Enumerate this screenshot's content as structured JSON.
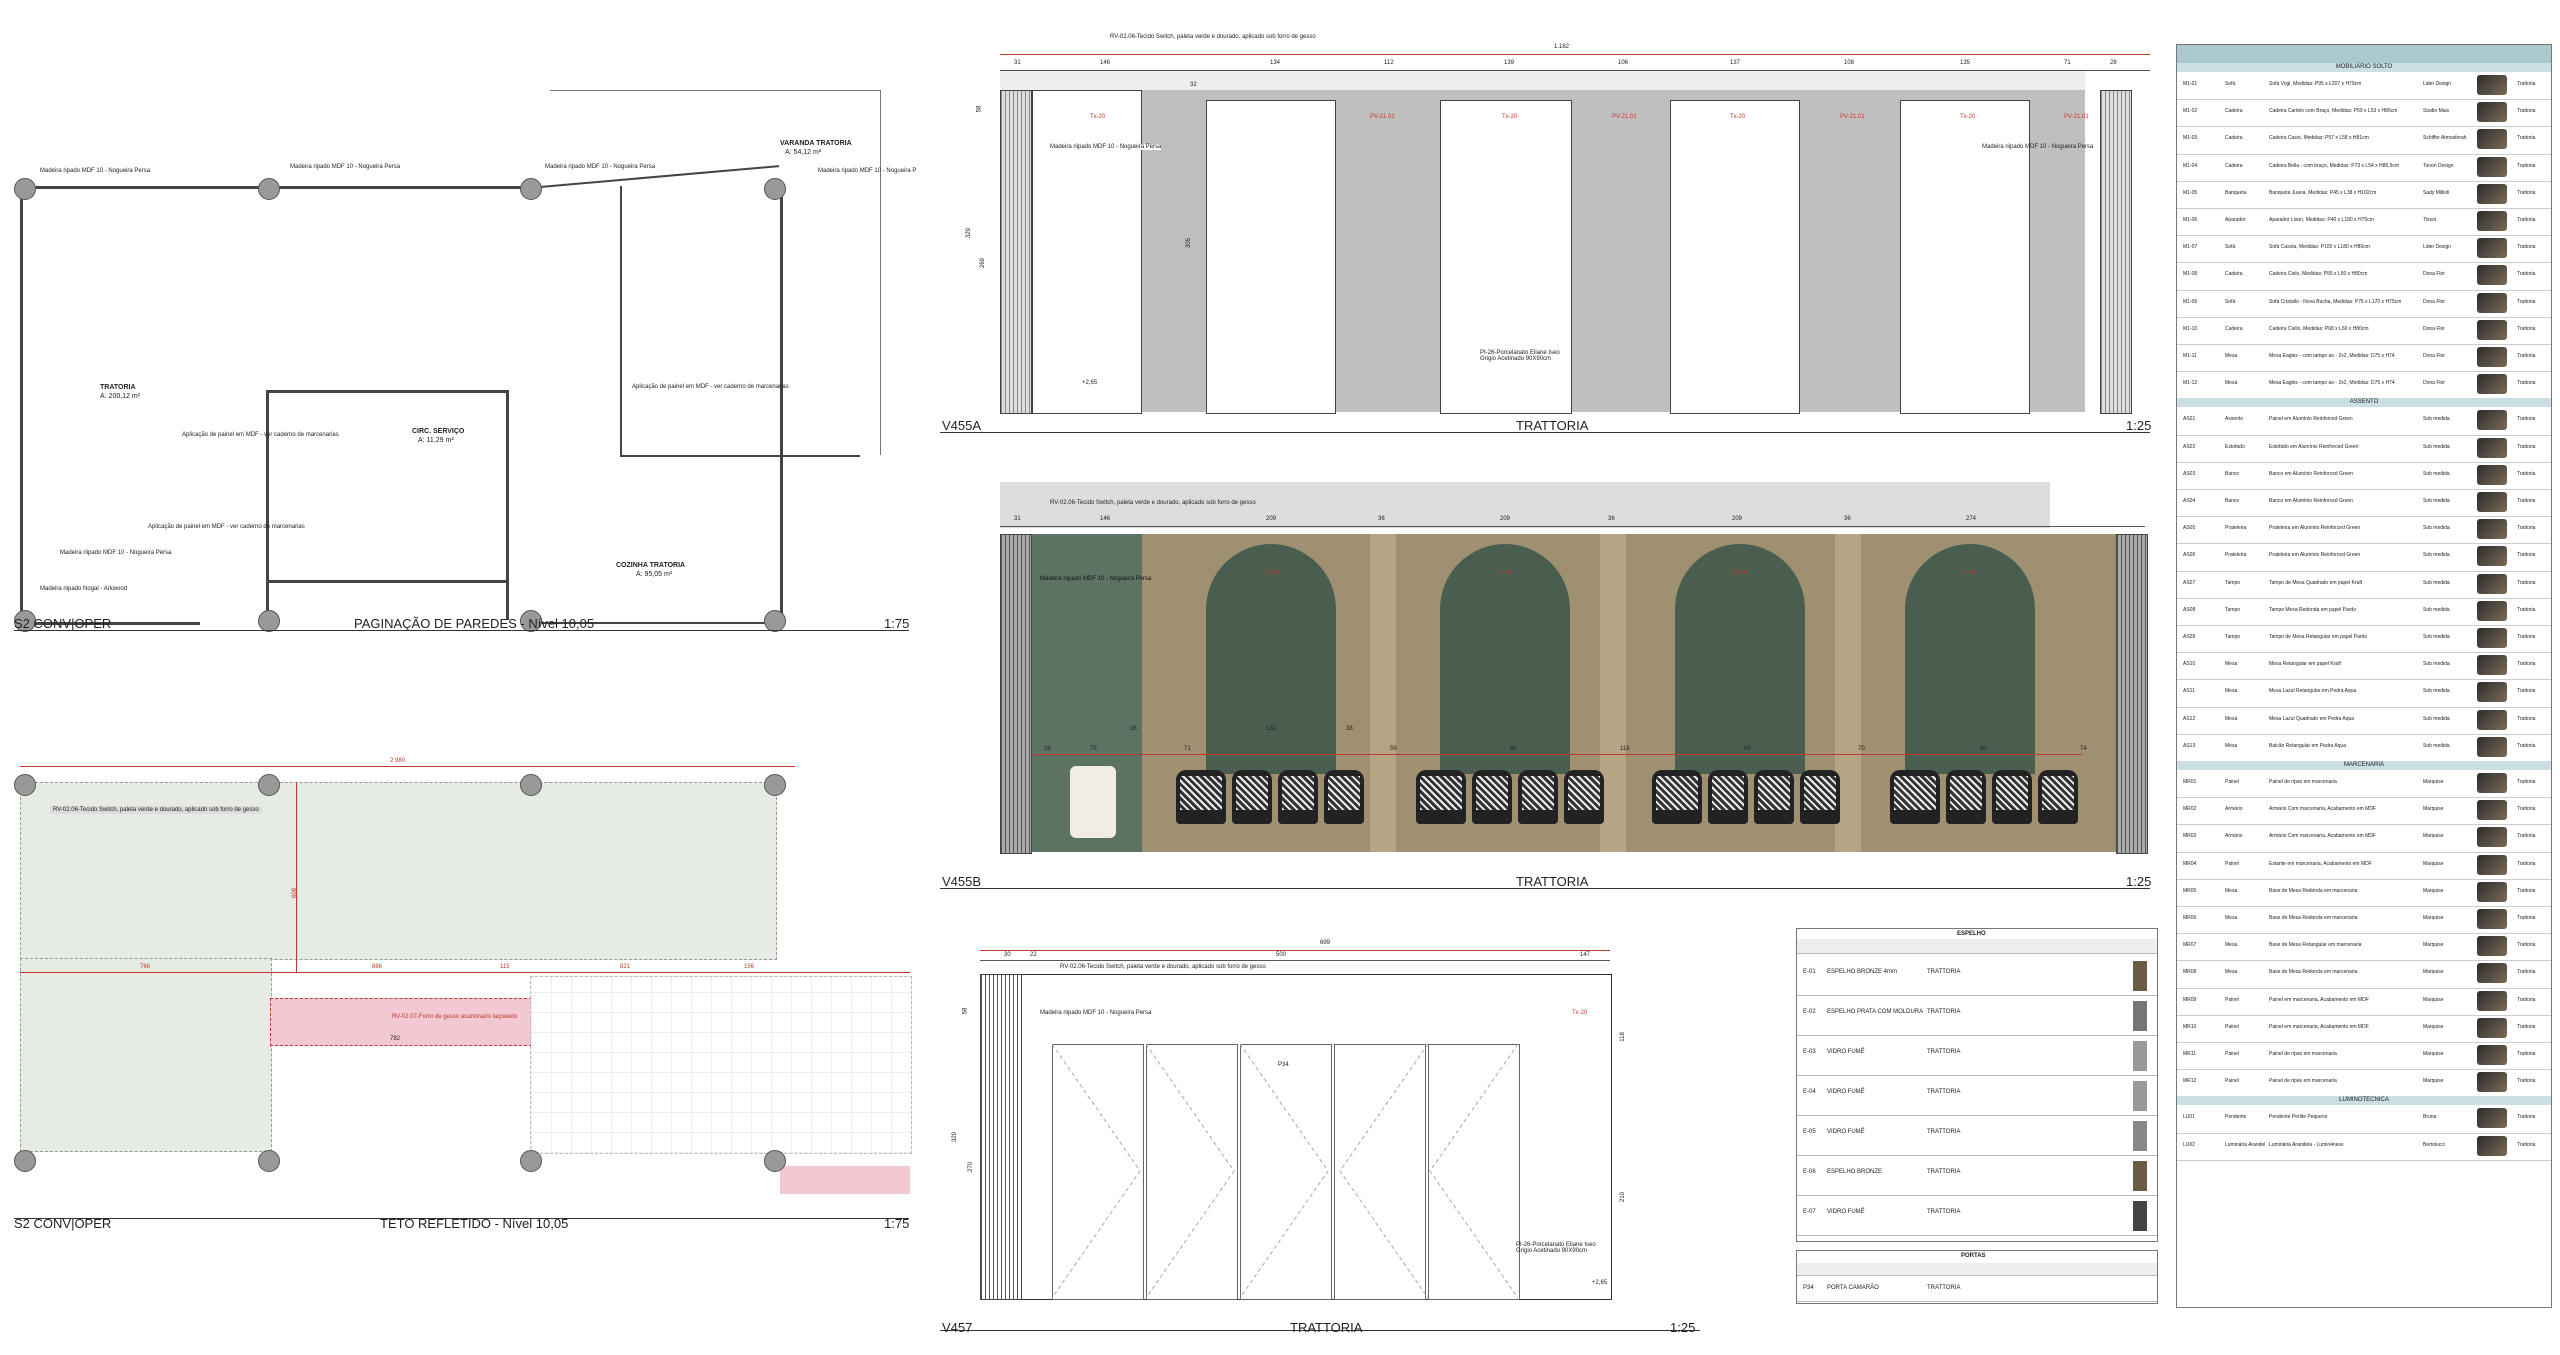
{
  "plan1": {
    "drawing_code": "S2 CONV|OPER",
    "title": "PAGINAÇÃO DE PAREDES - Nível 10,05",
    "scale": "1:75",
    "rooms": [
      {
        "name": "TRATORIA",
        "area": "A: 200,12 m²"
      },
      {
        "name": "VARANDA TRATORIA",
        "area": "A: 54,12 m²"
      },
      {
        "name": "CIRC. SERVIÇO",
        "area": "A: 11,29 m²"
      },
      {
        "name": "COZINHA TRATORIA",
        "area": "A: 95,05 m²"
      }
    ],
    "notes": [
      "Madeira ripado MDF 10 - Nogueira Persa",
      "Madeira ripado MDF 10 - Nogueira Persa",
      "Madeira ripado MDF 10 - Nogueira Persa",
      "Madeira ripado MDF 10 - Nogueira P",
      "Aplicação de painel em MDF - ver caderno de marcenarias",
      "Aplicação de painel em MDF - ver caderno de marcenarias",
      "Aplicação de painel em MDF - ver caderno de marcenarias",
      "Madeira riipado Nogal - Arkwood",
      "Madeira riipado MDF 10 - Nogueira Persa"
    ]
  },
  "plan2": {
    "drawing_code": "S2 CONV|OPER",
    "title": "TETO REFLETIDO - Nível 10,05",
    "scale": "1:75",
    "notes": [
      "RV-02.06-Tecido Switch, paleta verde e dourado, aplicado sob forro de gesso",
      "RV-02.07-Forro de gesso acartonado laqueado"
    ],
    "dims": [
      "2.980",
      "766",
      "866",
      "115",
      "821",
      "156",
      "608",
      "782"
    ]
  },
  "elev_a": {
    "code": "V455A",
    "title": "TRATTORIA",
    "scale": "1:25",
    "top_note": "RV-02.06-Tecido Switch, paleta verde e dourado, aplicado sob forro de gesso",
    "total_dim": "1.182",
    "dims": [
      "31",
      "146",
      "32",
      "134",
      "112",
      "139",
      "106",
      "137",
      "108",
      "135",
      "71",
      "28"
    ],
    "notes": [
      "Madeira riipado MDF 10 - Nogueira Persa",
      "Madeira riipado MDF 10 - Nogueira Persa",
      "PI-26-Porcelanato Eliane Iseo Grigio Acetinado 90X90cm"
    ],
    "tags": [
      "Tx-20",
      "PV-21.01",
      "Tx-20",
      "PV-21.01",
      "Tx-20",
      "PV-21.01",
      "Tx-20",
      "PV-21.01"
    ],
    "level": "+2,65",
    "vert_dims": [
      "329",
      "269",
      "305",
      "58"
    ]
  },
  "elev_b": {
    "code": "V455B",
    "title": "TRATTORIA",
    "scale": "1:25",
    "top_note": "RV-02.06-Tecido Switch, paleta verde e dourado, aplicado sob forro de gesso",
    "dims": [
      "31",
      "146",
      "209",
      "36",
      "209",
      "36",
      "209",
      "36",
      "274"
    ],
    "lower_dims": [
      "29",
      "75",
      "28",
      "71",
      "132",
      "38",
      "59",
      "80",
      "118",
      "89",
      "70",
      "80",
      "74"
    ],
    "notes": [
      "Madeira riipado MDF 10 - Nogueira Persa"
    ],
    "tags": [
      "Tx-20",
      "Tx-20",
      "Tx-20",
      "Tx-20"
    ]
  },
  "elev_c": {
    "code": "V457",
    "title": "TRATTORIA",
    "scale": "1:25",
    "top_note": "RV-02.06-Tecido Switch, paleta verde e dourado, aplicado sob forro de gesso",
    "total_dim": "699",
    "dims": [
      "30",
      "22",
      "500",
      "147"
    ],
    "notes": [
      "Madeira riipado MDF 10 - Nogueira Persa",
      "PI-26-Porcelanato Eliane Iseo Grigio Acetinado 90X90cm"
    ],
    "tag": "Tx-20",
    "door_tag": "P34",
    "level": "+2,65",
    "vert_dims": [
      "58",
      "329",
      "270",
      "118",
      "210"
    ]
  },
  "schedule": {
    "sections": [
      "MOBILIÁRIO SOLTO",
      "ASSENTO",
      "MARCENARIA",
      "LUMINOTECNICA"
    ],
    "rows": [
      {
        "code": "M1-01",
        "item": "Sofá",
        "desc": "Sofá Vogl, Medidas: P95 x L207 x H79cm",
        "supplier": "Lider Design",
        "loc": "Trattoria"
      },
      {
        "code": "M1-02",
        "item": "Cadeira",
        "desc": "Cadeira Carteio com Braço, Medidas: P59 x L53 x H86cm",
        "supplier": "Studio Mais",
        "loc": "Trattoria"
      },
      {
        "code": "M1-03",
        "item": "Cadeira",
        "desc": "Cadeira Casio, Medidas: P57 x L58 x H81cm",
        "supplier": "Schiffer Atmosferah",
        "loc": "Trattoria"
      },
      {
        "code": "M1-04",
        "item": "Cadeira",
        "desc": "Cadeira Bella - com braço, Medidas: P73 x L54 x H86,5cm",
        "supplier": "Tonon Design",
        "loc": "Trattoria"
      },
      {
        "code": "M1-05",
        "item": "Banqueta",
        "desc": "Banqueta Juana, Medidas: P45 x L38 x H102cm",
        "supplier": "Sady Millioli",
        "loc": "Trattoria"
      },
      {
        "code": "M1-06",
        "item": "Aparador",
        "desc": "Aparador Lison, Medidas: P40 x L180 x H75cm",
        "supplier": "Tissot",
        "loc": "Trattoria"
      },
      {
        "code": "M1-07",
        "item": "Sofá",
        "desc": "Sofá Casola, Medidas: P100 x L180 x H80cm",
        "supplier": "Lider Design",
        "loc": "Trattoria"
      },
      {
        "code": "M1-08",
        "item": "Cadeira",
        "desc": "Cadeira Cielo, Medidas: P55 x L50 x H80cm",
        "supplier": "Dona Flor",
        "loc": "Trattoria"
      },
      {
        "code": "M1-09",
        "item": "Sofá",
        "desc": "Sofá Cristallo - Nova Bucha, Medidas: P75 x L170 x H75cm",
        "supplier": "Dona Flor",
        "loc": "Trattoria"
      },
      {
        "code": "M1-10",
        "item": "Cadeira",
        "desc": "Cadeira Ciello, Medidas: P68 x L60 x H80cm",
        "supplier": "Dona Flor",
        "loc": "Trattoria"
      },
      {
        "code": "M1-11",
        "item": "Mesa",
        "desc": "Mesa Eagles - com tampo ao - 2x2, Medidas: D75 x H74",
        "supplier": "Dona Flor",
        "loc": "Trattoria"
      },
      {
        "code": "M1-12",
        "item": "Mesa",
        "desc": "Mesa Eagles - com tampo ao - 2x2, Medidas: D75 x H74",
        "supplier": "Dona Flor",
        "loc": "Trattoria"
      },
      {
        "code": "AS01",
        "item": "Assento",
        "desc": "Painel em Alumínio Reinforced Green",
        "supplier": "Sob medida",
        "loc": "Trattoria"
      },
      {
        "code": "AS02",
        "item": "Estofado",
        "desc": "Estofado em Alumínio Reinforced Green",
        "supplier": "Sob medida",
        "loc": "Trattoria"
      },
      {
        "code": "AS03",
        "item": "Banco",
        "desc": "Banco em Alumínio Reinforced Green",
        "supplier": "Sob medida",
        "loc": "Trattoria"
      },
      {
        "code": "AS04",
        "item": "Banco",
        "desc": "Banco em Alumínio Reinforced Green",
        "supplier": "Sob medida",
        "loc": "Trattoria"
      },
      {
        "code": "AS05",
        "item": "Prateleira",
        "desc": "Prateleira em Alumínio Reinforced Green",
        "supplier": "Sob medida",
        "loc": "Trattoria"
      },
      {
        "code": "AS06",
        "item": "Prateleira",
        "desc": "Prateleira em Alumínio Reinforced Green",
        "supplier": "Sob medida",
        "loc": "Trattoria"
      },
      {
        "code": "AS07",
        "item": "Tampo",
        "desc": "Tampo de Mesa Quadrado em papel Kraft",
        "supplier": "Sob medida",
        "loc": "Trattoria"
      },
      {
        "code": "AS08",
        "item": "Tampo",
        "desc": "Tampo Mesa Redonda em papel Pardo",
        "supplier": "Sob medida",
        "loc": "Trattoria"
      },
      {
        "code": "AS09",
        "item": "Tampo",
        "desc": "Tampo de Mesa Retangular em papel Pardo",
        "supplier": "Sob medida",
        "loc": "Trattoria"
      },
      {
        "code": "AS10",
        "item": "Mesa",
        "desc": "Mesa Retangular em papel Kraft",
        "supplier": "Sob medida",
        "loc": "Trattoria"
      },
      {
        "code": "AS11",
        "item": "Mesa",
        "desc": "Mesa Lazul Retangular em Pedra Aqua",
        "supplier": "Sob medida",
        "loc": "Trattoria"
      },
      {
        "code": "AS12",
        "item": "Mesa",
        "desc": "Mesa Lazul Quadrado em Pedra Aqua",
        "supplier": "Sob medida",
        "loc": "Trattoria"
      },
      {
        "code": "AS13",
        "item": "Mesa",
        "desc": "Balcão Retangular em Pedra Aqua",
        "supplier": "Sob medida",
        "loc": "Trattoria"
      },
      {
        "code": "MR01",
        "item": "Painel",
        "desc": "Painel de ripas em marcenaria",
        "supplier": "Marquise",
        "loc": "Trattoria"
      },
      {
        "code": "MR02",
        "item": "Armário",
        "desc": "Armário Com marcenaria, Acabamento em MDF",
        "supplier": "Marquise",
        "loc": "Trattoria"
      },
      {
        "code": "MR03",
        "item": "Armário",
        "desc": "Armário Com marcenaria, Acabamento em MDF",
        "supplier": "Marquise",
        "loc": "Trattoria"
      },
      {
        "code": "MR04",
        "item": "Painel",
        "desc": "Estante em marcenaria, Acabamento em MDF",
        "supplier": "Marquise",
        "loc": "Trattoria"
      },
      {
        "code": "MR05",
        "item": "Mesa",
        "desc": "Base de Mesa Redonda em marcenaria",
        "supplier": "Marquise",
        "loc": "Trattoria"
      },
      {
        "code": "MR06",
        "item": "Mesa",
        "desc": "Base de Mesa Redonda em marcenaria",
        "supplier": "Marquise",
        "loc": "Trattoria"
      },
      {
        "code": "MR07",
        "item": "Mesa",
        "desc": "Base de Mesa Retangular em marcenaria",
        "supplier": "Marquise",
        "loc": "Trattoria"
      },
      {
        "code": "MR08",
        "item": "Mesa",
        "desc": "Base de Mesa Redonda em marcenaria",
        "supplier": "Marquise",
        "loc": "Trattoria"
      },
      {
        "code": "MR09",
        "item": "Painel",
        "desc": "Painel em marcenaria, Acabamento em MDF",
        "supplier": "Marquise",
        "loc": "Trattoria"
      },
      {
        "code": "MR10",
        "item": "Painel",
        "desc": "Painel em marcenaria, Acabamento em MDF",
        "supplier": "Marquise",
        "loc": "Trattoria"
      },
      {
        "code": "MR11",
        "item": "Painel",
        "desc": "Painel de ripas em marcenaria",
        "supplier": "Marquise",
        "loc": "Trattoria"
      },
      {
        "code": "MR12",
        "item": "Painel",
        "desc": "Painel de ripas em marcenaria",
        "supplier": "Marquise",
        "loc": "Trattoria"
      },
      {
        "code": "LU01",
        "item": "Pendente",
        "desc": "Pendente Perlite Pequeno",
        "supplier": "Bruna",
        "loc": "Trattoria"
      },
      {
        "code": "LU02",
        "item": "Luminária Arandela",
        "desc": "Luminária Arandela - Lumin4ness",
        "supplier": "Bertolucci",
        "loc": "Trattoria"
      }
    ]
  },
  "small_table": {
    "header": "ESPELHO",
    "footer_header": "PORTAS",
    "rows": [
      {
        "code": "E-01",
        "desc": "ESPELHO BRONZE 4mm",
        "loc": "TRATTORIA"
      },
      {
        "code": "E-02",
        "desc": "ESPELHO PRATA COM MOLDURA",
        "loc": "TRATTORIA"
      },
      {
        "code": "E-03",
        "desc": "VIDRO FUMÊ",
        "loc": "TRATTORIA"
      },
      {
        "code": "E-04",
        "desc": "VIDRO FUMÊ",
        "loc": "TRATTORIA"
      },
      {
        "code": "E-05",
        "desc": "VIDRO FUMÊ",
        "loc": "TRATTORIA"
      },
      {
        "code": "E-06",
        "desc": "ESPELHO BRONZE",
        "loc": "TRATTORIA"
      },
      {
        "code": "E-07",
        "desc": "VIDRO FUMÊ",
        "loc": "TRATTORIA"
      }
    ],
    "door_row": {
      "code": "P34",
      "desc": "PORTA CAMARÃO",
      "loc": "TRATTORIA"
    }
  }
}
